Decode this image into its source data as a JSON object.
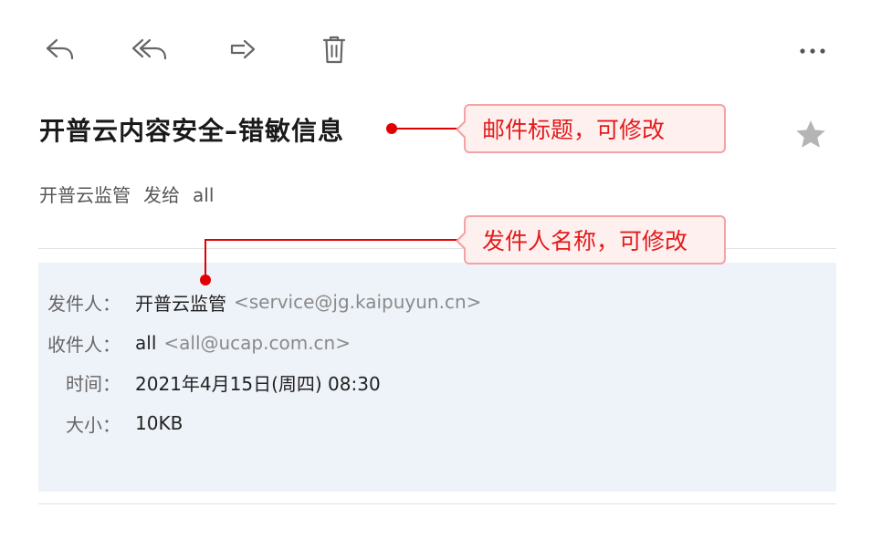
{
  "toolbar": {
    "reply_icon": "reply-icon",
    "reply_all_icon": "reply-all-icon",
    "forward_icon": "forward-icon",
    "delete_icon": "trash-icon",
    "more_icon": "more-icon"
  },
  "email": {
    "subject": "开普云内容安全–错敏信息",
    "summary": {
      "sender": "开普云监管",
      "sent_to": "发给",
      "recipient": "all"
    },
    "details": {
      "from_label": "发件人：",
      "from_name": "开普云监管",
      "from_addr": "<service@jg.kaipuyun.cn>",
      "to_label": "收件人：",
      "to_name": "all",
      "to_addr": "<all@ucap.com.cn>",
      "time_label": "时间：",
      "time_value": "2021年4月15日(周四) 08:30",
      "size_label": "大小：",
      "size_value": "10KB"
    }
  },
  "annotations": {
    "subject_note": "邮件标题，可修改",
    "sender_note": "发件人名称，可修改",
    "color": "#e00000"
  },
  "colors": {
    "detail_bg": "#eef2f9",
    "callout_bg": "#fff0f0",
    "callout_border": "#f3a3a3"
  }
}
